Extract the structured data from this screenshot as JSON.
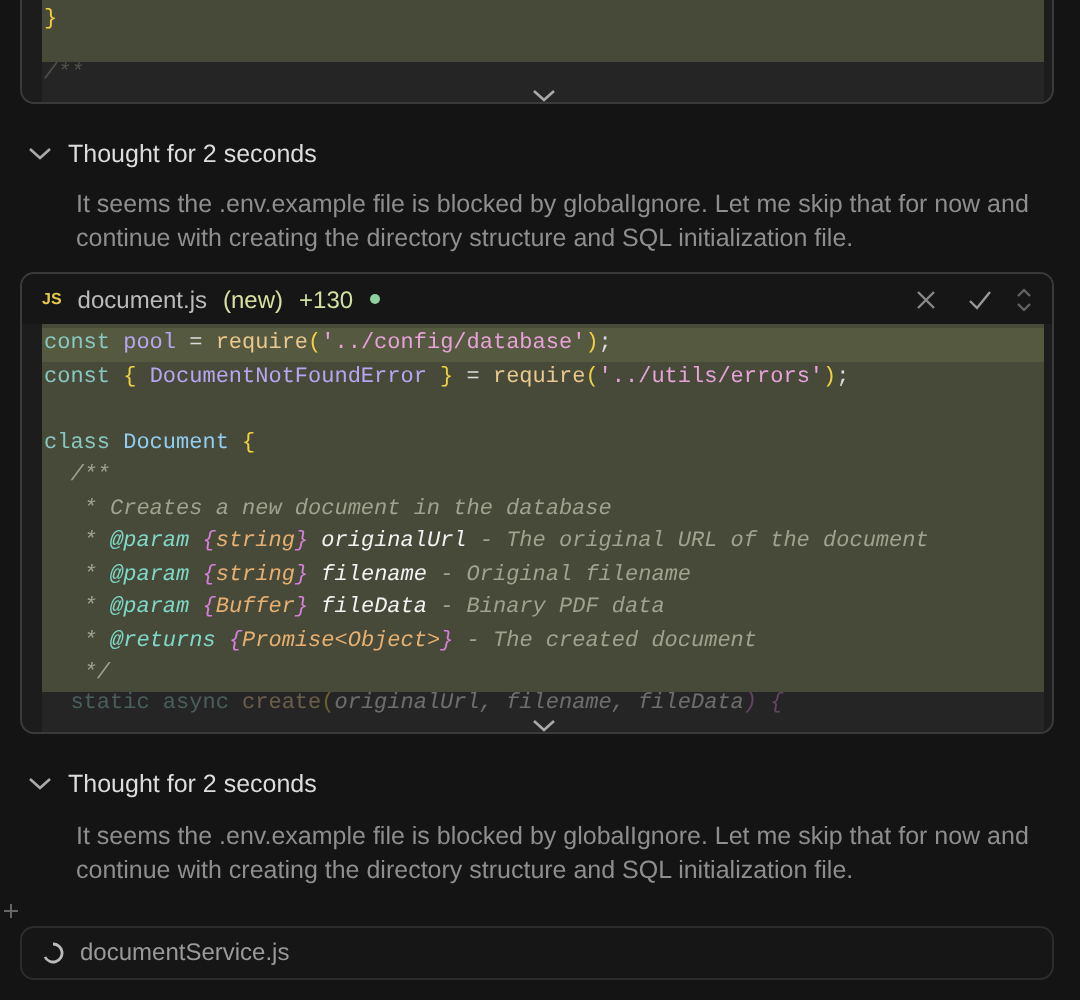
{
  "blocks": [
    {
      "kind": "editor",
      "lines": [
        {
          "current": false,
          "tokens": [
            {
              "t": "}",
              "kind": "brace"
            }
          ]
        }
      ],
      "faded_line": [
        {
          "t": "/**",
          "kind": "comment"
        }
      ]
    },
    {
      "kind": "thought",
      "title": "Thought for 2 seconds",
      "expanded": true,
      "text": "It seems the .env.example file is blocked by globalIgnore. Let me skip that for now and continue with creating the directory structure and SQL initialization file."
    },
    {
      "kind": "editor",
      "header": {
        "badge": "JS",
        "filename": "document.js",
        "status": "(new)",
        "additions": "+130"
      },
      "lines": [
        {
          "current": true,
          "tokens": [
            {
              "t": "const ",
              "kind": "keyword"
            },
            {
              "t": "pool",
              "kind": "ident"
            },
            {
              "t": " = ",
              "kind": "op"
            },
            {
              "t": "require",
              "kind": "fn"
            },
            {
              "t": "(",
              "kind": "brace"
            },
            {
              "t": "'../config/database'",
              "kind": "str"
            },
            {
              "t": ")",
              "kind": "brace"
            },
            {
              "t": ";",
              "kind": "op"
            }
          ]
        },
        {
          "current": false,
          "tokens": [
            {
              "t": "const ",
              "kind": "keyword"
            },
            {
              "t": "{",
              "kind": "brace"
            },
            {
              "t": " DocumentNotFoundError ",
              "kind": "ident"
            },
            {
              "t": "}",
              "kind": "brace"
            },
            {
              "t": " = ",
              "kind": "op"
            },
            {
              "t": "require",
              "kind": "fn"
            },
            {
              "t": "(",
              "kind": "brace"
            },
            {
              "t": "'../utils/errors'",
              "kind": "str"
            },
            {
              "t": ")",
              "kind": "brace"
            },
            {
              "t": ";",
              "kind": "op"
            }
          ]
        },
        {
          "current": false
        },
        {
          "current": false,
          "tokens": [
            {
              "t": "class ",
              "kind": "keyword"
            },
            {
              "t": "Document ",
              "kind": "cls"
            },
            {
              "t": "{",
              "kind": "brace"
            }
          ]
        },
        {
          "current": false,
          "tokens": [
            {
              "t": "  /**",
              "kind": "comment"
            }
          ]
        },
        {
          "current": false,
          "tokens": [
            {
              "t": "   * Creates a new document in the database",
              "kind": "comment"
            }
          ]
        },
        {
          "current": false,
          "tokens": [
            {
              "t": "   * ",
              "kind": "comment"
            },
            {
              "t": "@param ",
              "kind": "tag"
            },
            {
              "t": "{",
              "kind": "typebrace"
            },
            {
              "t": "string",
              "kind": "type"
            },
            {
              "t": "}",
              "kind": "typebrace"
            },
            {
              "t": " originalUrl",
              "kind": "param"
            },
            {
              "t": " - The original URL of the document",
              "kind": "comment"
            }
          ]
        },
        {
          "current": false,
          "tokens": [
            {
              "t": "   * ",
              "kind": "comment"
            },
            {
              "t": "@param ",
              "kind": "tag"
            },
            {
              "t": "{",
              "kind": "typebrace"
            },
            {
              "t": "string",
              "kind": "type"
            },
            {
              "t": "}",
              "kind": "typebrace"
            },
            {
              "t": " filename",
              "kind": "param"
            },
            {
              "t": " - Original filename",
              "kind": "comment"
            }
          ]
        },
        {
          "current": false,
          "tokens": [
            {
              "t": "   * ",
              "kind": "comment"
            },
            {
              "t": "@param ",
              "kind": "tag"
            },
            {
              "t": "{",
              "kind": "typebrace"
            },
            {
              "t": "Buffer",
              "kind": "type"
            },
            {
              "t": "}",
              "kind": "typebrace"
            },
            {
              "t": " fileData",
              "kind": "param"
            },
            {
              "t": " - Binary PDF data",
              "kind": "comment"
            }
          ]
        },
        {
          "current": false,
          "tokens": [
            {
              "t": "   * ",
              "kind": "comment"
            },
            {
              "t": "@returns ",
              "kind": "tag"
            },
            {
              "t": "{",
              "kind": "typebrace"
            },
            {
              "t": "Promise<Object>",
              "kind": "type"
            },
            {
              "t": "}",
              "kind": "typebrace"
            },
            {
              "t": " - The created document",
              "kind": "comment"
            }
          ]
        },
        {
          "current": false,
          "tokens": [
            {
              "t": "   */",
              "kind": "comment"
            }
          ]
        }
      ],
      "faded_line": [
        {
          "t": "  static async ",
          "kind": "keyword"
        },
        {
          "t": "create",
          "kind": "fn"
        },
        {
          "t": "(",
          "kind": "brace"
        },
        {
          "t": "originalUrl, filename, fileData",
          "kind": "param"
        },
        {
          "t": ") {",
          "kind": "typebrace"
        }
      ]
    },
    {
      "kind": "thought",
      "title": "Thought for 2 seconds",
      "expanded": true,
      "text": "It seems the .env.example file is blocked by globalIgnore. Let me skip that for now and continue with creating the directory structure and SQL initialization file."
    },
    {
      "kind": "file",
      "filename": "documentService.js",
      "loading": true
    }
  ]
}
